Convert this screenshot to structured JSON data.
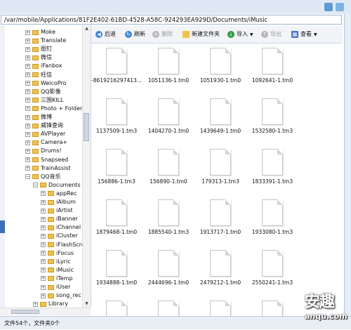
{
  "path": "/var/mobile/Applications/81F2E402-61BD-4528-A58C-924293EA929D/Documents/iMusic",
  "tree_items": [
    {
      "label": "Moke",
      "level": 0,
      "expanded": false
    },
    {
      "label": "Translate",
      "level": 0,
      "expanded": false
    },
    {
      "label": "图钉",
      "level": 0,
      "expanded": false
    },
    {
      "label": "微信",
      "level": 0,
      "expanded": false
    },
    {
      "label": "iFanbox",
      "level": 0,
      "expanded": false
    },
    {
      "label": "旺信",
      "level": 0,
      "expanded": false
    },
    {
      "label": "WeicoPro",
      "level": 0,
      "expanded": false
    },
    {
      "label": "QQ影像",
      "level": 0,
      "expanded": false
    },
    {
      "label": "三国KILL",
      "level": 0,
      "expanded": false
    },
    {
      "label": "Photo + Folder",
      "level": 0,
      "expanded": false
    },
    {
      "label": "微博",
      "level": 0,
      "expanded": false
    },
    {
      "label": "威锋查询",
      "level": 0,
      "expanded": false
    },
    {
      "label": "AVPlayer",
      "level": 0,
      "expanded": false
    },
    {
      "label": "Camera+",
      "level": 0,
      "expanded": false
    },
    {
      "label": "Drums!",
      "level": 0,
      "expanded": false
    },
    {
      "label": "Snapseed",
      "level": 0,
      "expanded": false
    },
    {
      "label": "TrainAssist",
      "level": 0,
      "expanded": false
    },
    {
      "label": "QQ音乐",
      "level": 0,
      "expanded": true
    },
    {
      "label": "Documents",
      "level": 1,
      "expanded": true
    },
    {
      "label": "appRec",
      "level": 2,
      "expanded": false
    },
    {
      "label": "iAlbum",
      "level": 2,
      "expanded": false
    },
    {
      "label": "iArtist",
      "level": 2,
      "expanded": false
    },
    {
      "label": "iBanner",
      "level": 2,
      "expanded": false
    },
    {
      "label": "iChannel",
      "level": 2,
      "expanded": false
    },
    {
      "label": "iCluster",
      "level": 2,
      "expanded": false
    },
    {
      "label": "iFlashScre",
      "level": 2,
      "expanded": false
    },
    {
      "label": "iFocus",
      "level": 2,
      "expanded": false
    },
    {
      "label": "iLyric",
      "level": 2,
      "expanded": false
    },
    {
      "label": "iMusic",
      "level": 2,
      "expanded": false
    },
    {
      "label": "iTemp",
      "level": 2,
      "expanded": false
    },
    {
      "label": "iUser",
      "level": 2,
      "expanded": false
    },
    {
      "label": "song_rec",
      "level": 2,
      "expanded": false
    },
    {
      "label": "Library",
      "level": 1,
      "expanded": false
    }
  ],
  "toolbar": {
    "back": "后退",
    "refresh": "刷新",
    "delete": "删除",
    "new_folder": "新建文件夹",
    "import": "导入",
    "export": "导出",
    "view": "查看"
  },
  "files": [
    "-8619216297413...",
    "1051136-1.tm0",
    "1051930-1.tm0",
    "1092641-1.tm0",
    "1137509-1.tm3",
    "1404270-1.tm0",
    "1439649-1.tm0",
    "1532580-1.tm3",
    "156886-1.tm3",
    "156890-1.tm0",
    "179313-1.tm3",
    "1833391-1.tm3",
    "1879468-1.tm0",
    "1885540-1.tm3",
    "1913717-1.tm0",
    "1933080-1.tm3",
    "1934888-1.tm0",
    "2444696-1.tm0",
    "2479212-1.tm0",
    "2550241-1.tm3",
    "",
    "",
    "",
    ""
  ],
  "status": "文件54个，文件夹0个",
  "watermark": {
    "main": "安趣",
    "url": "anqu.com"
  }
}
